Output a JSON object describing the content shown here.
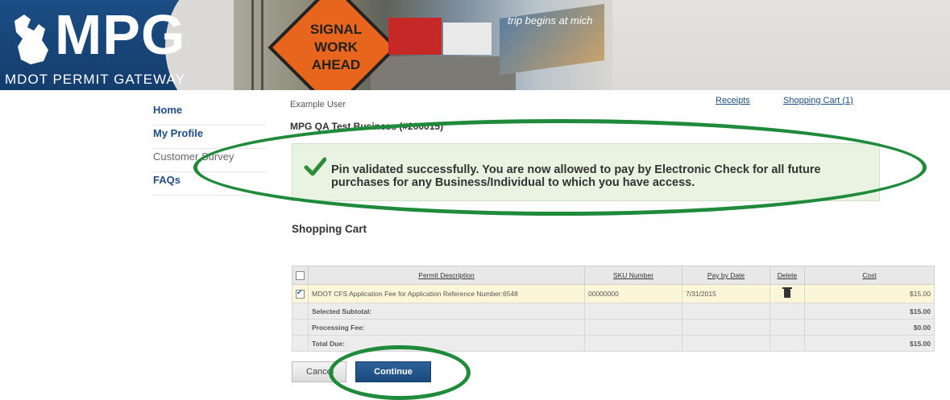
{
  "header": {
    "logo_text": "MPG",
    "logo_subtitle": "MDOT PERMIT GATEWAY",
    "sign_line1": "SIGNAL",
    "sign_line2": "WORK",
    "sign_line3": "AHEAD",
    "billboard_text": "trip begins at mich"
  },
  "nav": {
    "items": [
      {
        "label": "Home"
      },
      {
        "label": "My Profile"
      },
      {
        "label": "Customer Survey"
      },
      {
        "label": "FAQs"
      }
    ]
  },
  "user": {
    "name": "Example User",
    "business": "MPG QA Test Business (#200015)",
    "receipts_link": "Receipts",
    "cart_link": "Shopping Cart (1)"
  },
  "message": {
    "text": "Pin validated successfully. You are now allowed to pay by Electronic Check for all future purchases for any Business/Individual to which you have access."
  },
  "cart": {
    "title": "Shopping Cart",
    "columns": [
      "Permit Description",
      "SKU Number",
      "Pay by Date",
      "Delete",
      "Cost"
    ],
    "items": [
      {
        "checked": true,
        "description": "MDOT CFS Application Fee for Application Reference Number:6548",
        "sku": "00000000",
        "pay_by": "7/31/2015",
        "cost": "$15.00"
      }
    ],
    "summary": [
      {
        "label": "Selected Subtotal:",
        "value": "$15.00"
      },
      {
        "label": "Processing Fee:",
        "value": "$0.00"
      },
      {
        "label": "Total Due:",
        "value": "$15.00"
      }
    ]
  },
  "buttons": {
    "cancel": "Cancel",
    "continue": "Continue"
  },
  "colors": {
    "brand_blue": "#1f4e85",
    "success_bg": "#e8f3e2",
    "annotation_green": "#1e8a3a"
  }
}
